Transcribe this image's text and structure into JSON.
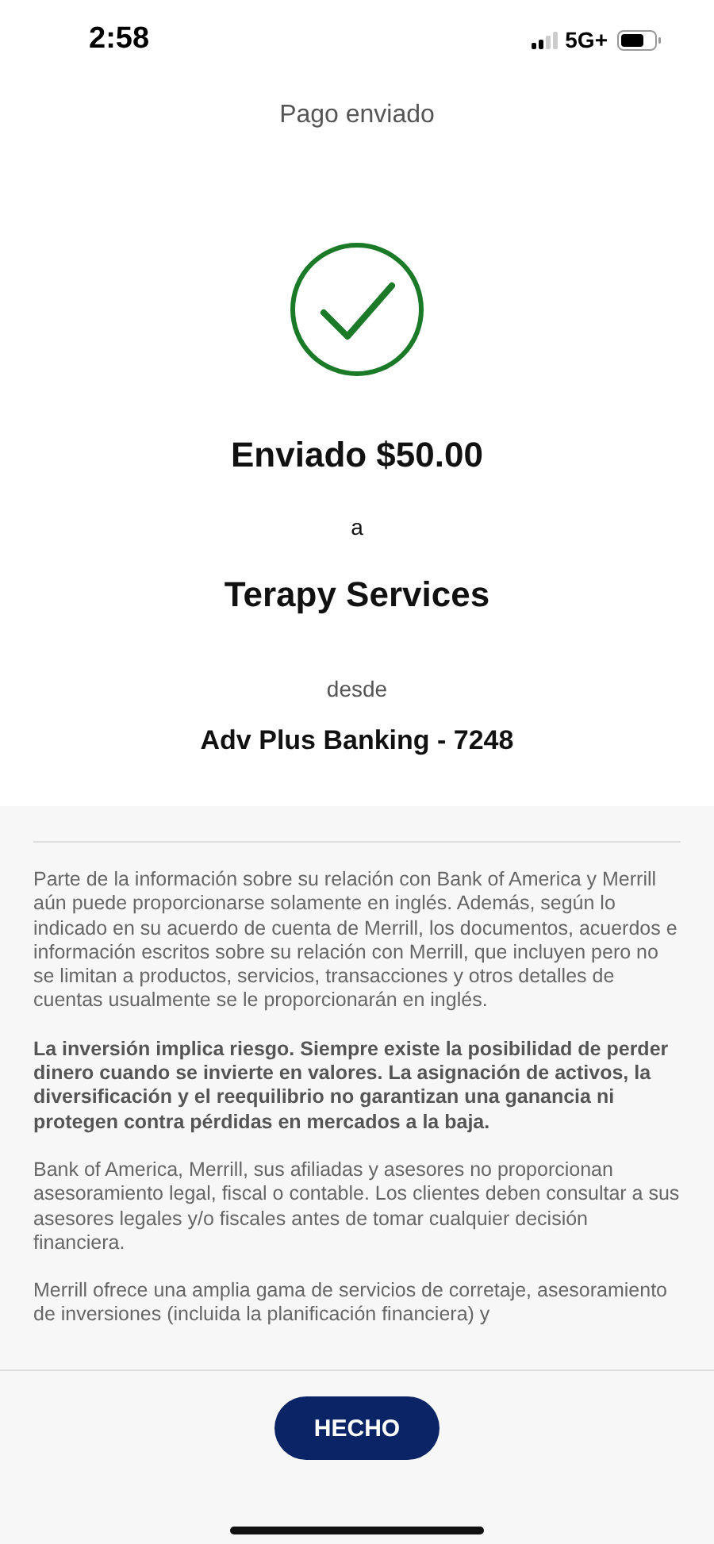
{
  "status_bar": {
    "time": "2:58",
    "network": "5G+"
  },
  "title": "Pago enviado",
  "confirmation": {
    "amount_line": "Enviado $50.00",
    "to_label": "a",
    "recipient": "Terapy Services",
    "from_label": "desde",
    "account": "Adv Plus Banking - 7248"
  },
  "disclosures": [
    {
      "kind": "plain",
      "text": "Parte de la información sobre su relación con Bank of America y Merrill aún puede proporcionarse solamente en inglés. Además, según lo indicado en su acuerdo de cuenta de Merrill, los documentos, acuerdos e información escritos sobre su relación con Merrill, que incluyen pero no se limitan a productos, servicios, transacciones y otros detalles de cuentas usualmente se le proporcionarán en inglés."
    },
    {
      "kind": "bold",
      "text": "La inversión implica riesgo. Siempre existe la posibilidad de perder dinero cuando se invierte en valores. La asignación de activos, la diversificación y el reequilibrio no garantizan una ganancia ni protegen contra pérdidas en mercados a la baja."
    },
    {
      "kind": "plain",
      "text": "Bank of America, Merrill, sus afiliadas y asesores no proporcionan asesoramiento legal, fiscal o contable. Los clientes deben consultar a sus asesores legales y/o fiscales antes de tomar cualquier decisión financiera."
    },
    {
      "kind": "plain",
      "text": "Merrill ofrece una amplia gama de servicios de corretaje, asesoramiento de inversiones (incluida la planificación financiera) y"
    }
  ],
  "done_button": "HECHO"
}
